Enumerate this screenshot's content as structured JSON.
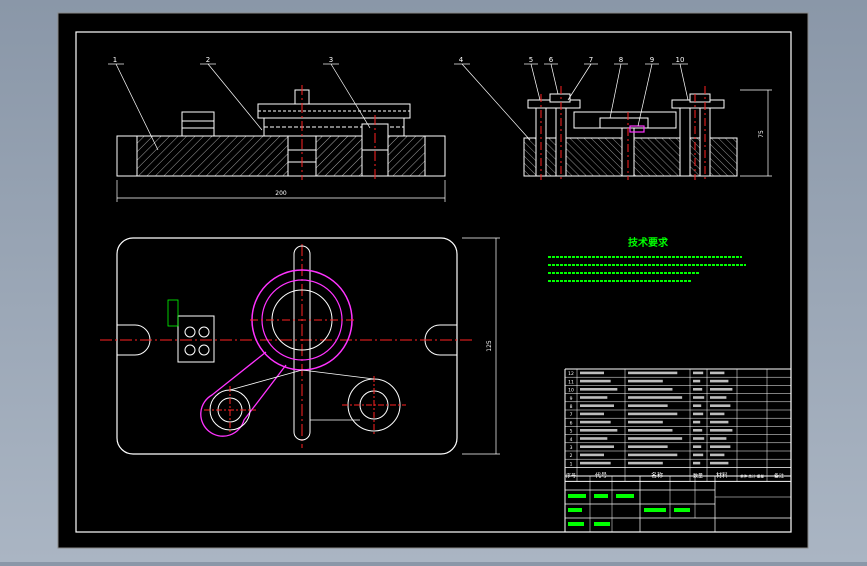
{
  "colors": {
    "background": "#000000",
    "frame": "#ffffff",
    "part_lines": "#ffffff",
    "hatch": "#cfcfcf",
    "center_lines": "#ff2222",
    "fixture_parts": "#ff33ff",
    "dimensions": "#ffffff",
    "technical_notes": "#00ff00",
    "table_text": "#ffffff"
  },
  "balloons": [
    "1",
    "2",
    "3",
    "4",
    "5",
    "6",
    "7",
    "8",
    "9",
    "10"
  ],
  "dimensions": {
    "front_width": "200",
    "side_height": "75",
    "plan_height": "125"
  },
  "technical_requirements": {
    "title": "技术要求"
  },
  "parts_table": {
    "header": {
      "index": "序号",
      "code": "代号",
      "name": "名称",
      "qty": "数量",
      "material": "材料",
      "weight": "单件 总计 重量",
      "remark": "备注"
    },
    "rows": [
      {
        "index": "12"
      },
      {
        "index": "11"
      },
      {
        "index": "10"
      },
      {
        "index": "9"
      },
      {
        "index": "8"
      },
      {
        "index": "7"
      },
      {
        "index": "6"
      },
      {
        "index": "5"
      },
      {
        "index": "4"
      },
      {
        "index": "3"
      },
      {
        "index": "2"
      },
      {
        "index": "1"
      }
    ]
  }
}
